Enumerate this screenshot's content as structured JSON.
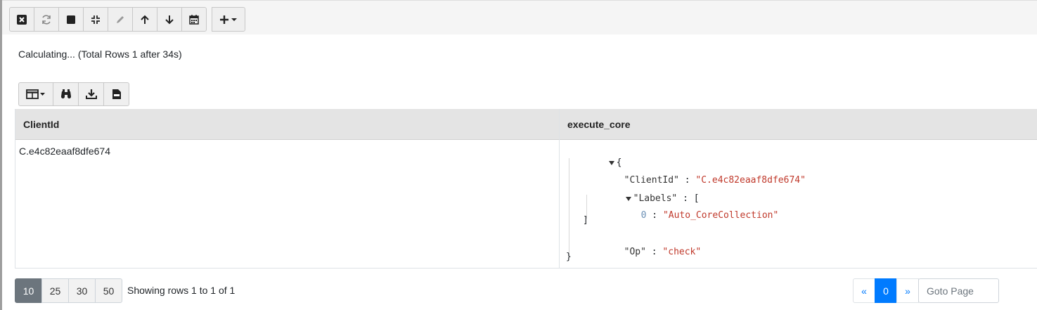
{
  "toolbar": {
    "buttons": [
      {
        "icon": "close-square-icon"
      },
      {
        "icon": "refresh-icon"
      },
      {
        "icon": "stop-icon"
      },
      {
        "icon": "compress-icon"
      },
      {
        "icon": "pencil-icon"
      },
      {
        "icon": "arrow-up-icon"
      },
      {
        "icon": "arrow-down-icon"
      },
      {
        "icon": "calendar-icon"
      },
      {
        "icon": "plus-dropdown-icon"
      }
    ]
  },
  "status": "Calculating... (Total Rows 1 after 34s)",
  "table_toolbar": {
    "buttons": [
      {
        "icon": "columns-dropdown-icon"
      },
      {
        "icon": "binoculars-icon"
      },
      {
        "icon": "download-icon"
      },
      {
        "icon": "csv-file-icon"
      }
    ]
  },
  "table": {
    "columns": [
      "ClientId",
      "execute_core"
    ],
    "rows": [
      {
        "ClientId": "C.e4c82eaaf8dfe674",
        "execute_core": {
          "open_brace": "{",
          "client_key": "\"ClientId\"",
          "client_value": "\"C.e4c82eaaf8dfe674\"",
          "labels_key": "\"Labels\"",
          "labels_open": "[",
          "label_index": "0",
          "label_value": "\"Auto_CoreCollection\"",
          "labels_close": "]",
          "op_key": "\"Op\"",
          "op_value": "\"check\"",
          "close_brace": "}",
          "separator": ":"
        }
      }
    ]
  },
  "pager": {
    "sizes": [
      "10",
      "25",
      "30",
      "50"
    ],
    "active_size": "10",
    "showing": "Showing rows 1 to 1 of 1",
    "prev": "«",
    "current": "0",
    "next": "»",
    "goto_placeholder": "Goto Page"
  }
}
